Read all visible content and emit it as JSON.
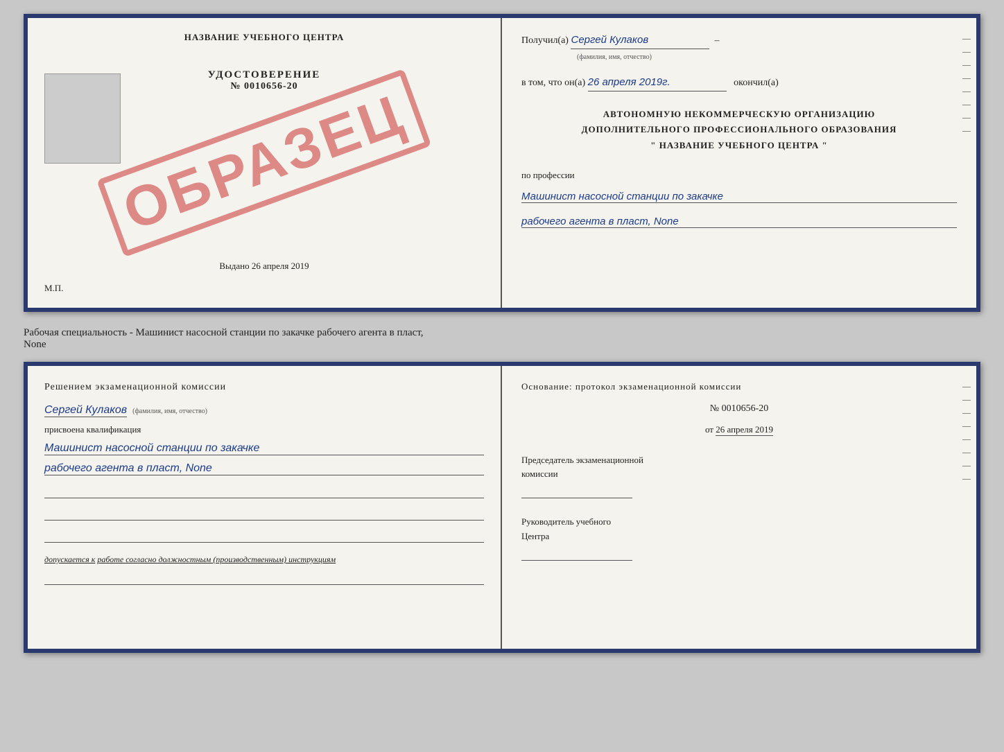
{
  "topCert": {
    "left": {
      "centerTitle": "НАЗВАНИЕ УЧЕБНОГО ЦЕНТРА",
      "udostoverenie": "УДОСТОВЕРЕНИЕ",
      "nomer": "№ 0010656-20",
      "obrazec": "ОБРАЗЕЦ",
      "vydano": "Выдано 26 апреля 2019",
      "mp": "М.П."
    },
    "right": {
      "poluchil": "Получил(а)",
      "fio": "Сергей Кулаков",
      "fioLabel": "(фамилия, имя, отчество)",
      "vtomChto": "в том, что он(а)",
      "date": "26 апреля 2019г.",
      "okonchil": "окончил(а)",
      "orgLine1": "АВТОНОМНУЮ НЕКОММЕРЧЕСКУЮ ОРГАНИЗАЦИЮ",
      "orgLine2": "ДОПОЛНИТЕЛЬНОГО ПРОФЕССИОНАЛЬНОГО ОБРАЗОВАНИЯ",
      "orgLine3": "\"   НАЗВАНИЕ УЧЕБНОГО ЦЕНТРА   \"",
      "poProf": "по профессии",
      "prof1": "Машинист насосной станции по закачке",
      "prof2": "рабочего агента в пласт, None"
    }
  },
  "middleLabel": "Рабочая специальность - Машинист насосной станции по закачке рабочего агента в пласт,\nNone",
  "bottomCert": {
    "left": {
      "reshenieTitle": "Решением  экзаменационной  комиссии",
      "fio": "Сергей Кулаков",
      "fioLabel": "(фамилия, имя, отчество)",
      "prisvoena": "присвоена квалификация",
      "qual1": "Машинист насосной станции по закачке",
      "qual2": "рабочего агента в пласт, None",
      "dopuskaetsyaLabel": "допускается к",
      "dopuskaetsyaText": "работе согласно должностным (производственным) инструкциям"
    },
    "right": {
      "osnovanie": "Основание: протокол экзаменационной комиссии",
      "nomer": "№  0010656-20",
      "ot": "от",
      "date": "26 апреля 2019",
      "predsedatel": "Председатель экзаменационной\nкомиссии",
      "rukovoditel": "Руководитель учебного\nЦентра"
    }
  }
}
